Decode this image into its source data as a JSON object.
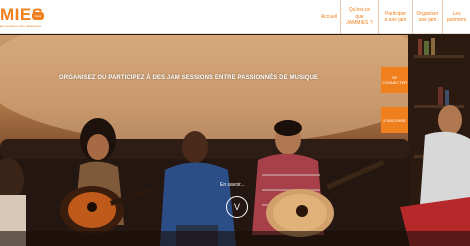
{
  "brand": {
    "logo_text": "MIES",
    "tagline": "jam sessions entre passionnés",
    "badge": "beta"
  },
  "nav": {
    "items": [
      {
        "label": "Accueil"
      },
      {
        "label": "Qu'est-ce que\nJAMMIES ?"
      },
      {
        "label": "Participer\nà une jam"
      },
      {
        "label": "Organiser\nune jam"
      },
      {
        "label": "Les jammers"
      }
    ]
  },
  "hero": {
    "headline": "ORGANISEZ OU PARTICIPEZ À DES JAM SESSIONS ENTRE PASSIONNÉS DE MUSIQUE",
    "connect_label": "SE\nCONNECTER",
    "register_label": "S'INSCRIRE",
    "scroll_label": "En savoir...",
    "scroll_icon": "V"
  },
  "colors": {
    "accent": "#f07f1d",
    "header_bg": "#ffffff"
  }
}
